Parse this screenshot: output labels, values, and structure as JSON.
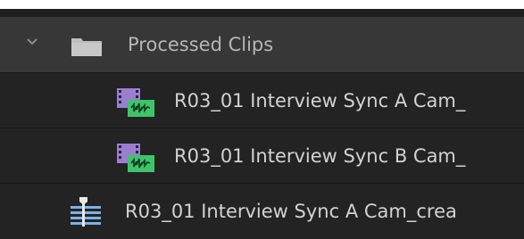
{
  "project_panel": {
    "folder": {
      "name": "Processed Clips",
      "icon": "folder-icon",
      "expand_icon": "chevron-down-icon"
    },
    "items": [
      {
        "name": "R03_01 Interview Sync A Cam_",
        "icon": "synced-clip-icon"
      },
      {
        "name": "R03_01 Interview Sync B Cam_",
        "icon": "synced-clip-icon"
      },
      {
        "name": "R03_01 Interview Sync A Cam_crea",
        "icon": "sequence-icon"
      }
    ]
  },
  "colors": {
    "background": "#1f1f1f",
    "folder_row": "#373737",
    "clip_purple": "#9a7fd1",
    "clip_green": "#3fc46b",
    "sequence_blue": "#7fb0e6"
  }
}
